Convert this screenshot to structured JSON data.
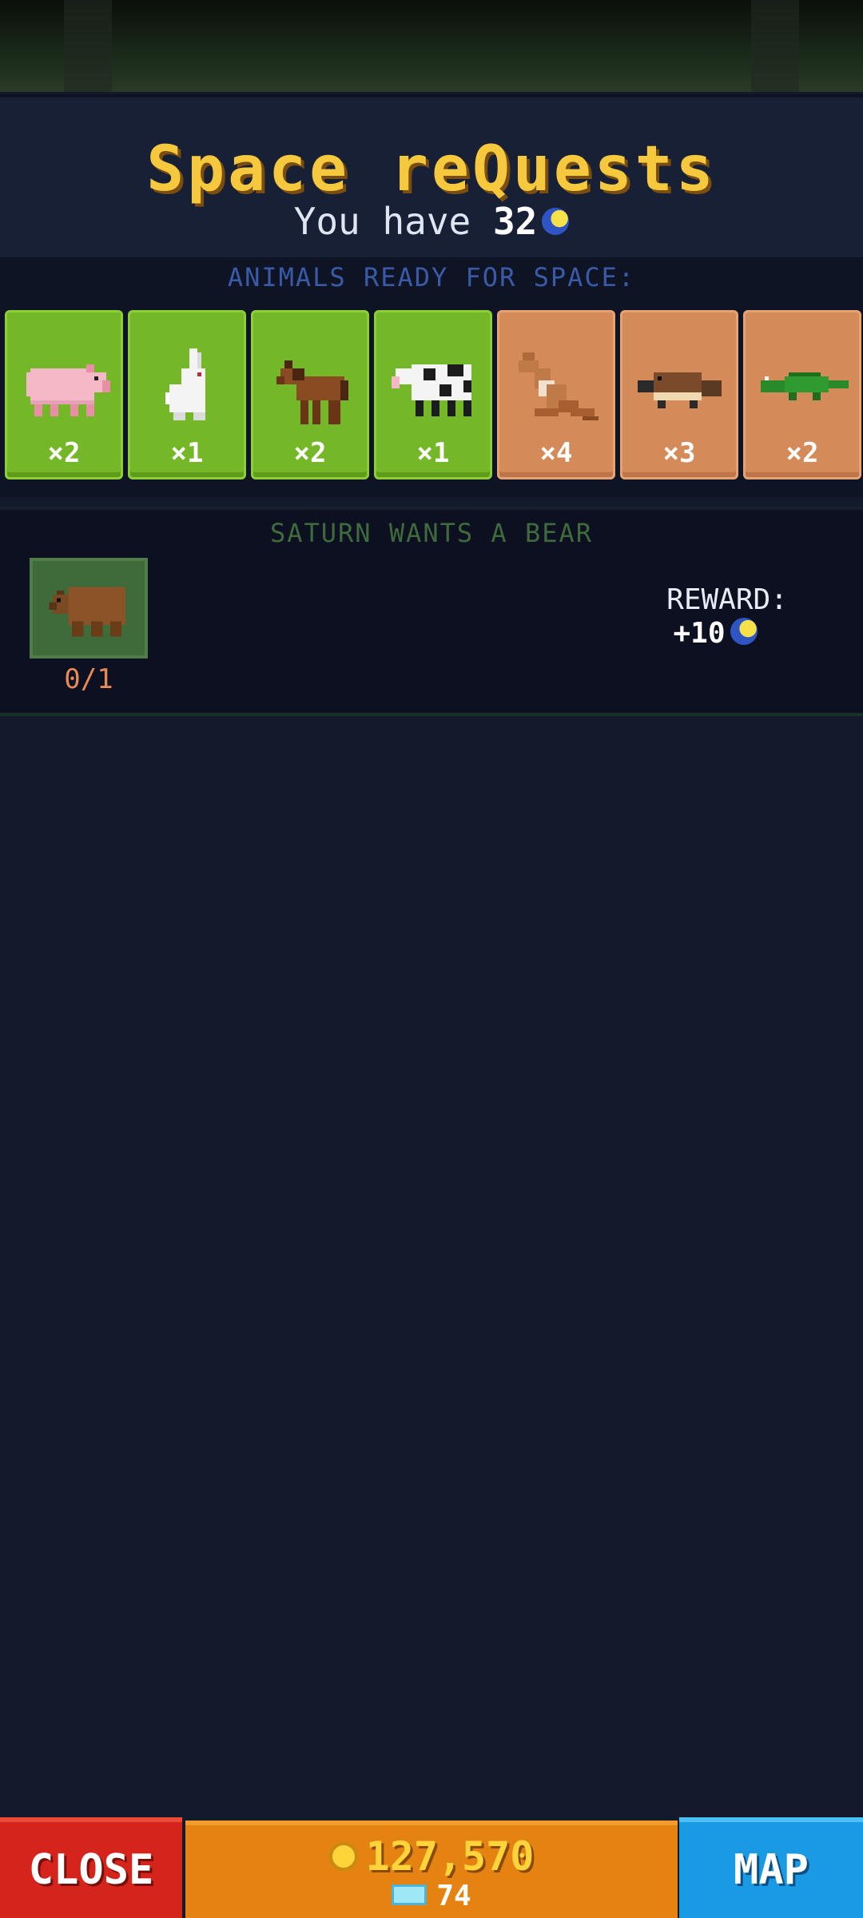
{
  "header": {
    "title": "Space reQuests",
    "you_have_prefix": "You have",
    "moon_coins": "32",
    "moon_icon": "moon-coin-icon"
  },
  "animals_ready": {
    "label": "ANIMALS READY FOR SPACE:",
    "cards": [
      {
        "animal": "pig",
        "count": "×2",
        "color": "#74b728"
      },
      {
        "animal": "rabbit",
        "count": "×1",
        "color": "#74b728"
      },
      {
        "animal": "horse",
        "count": "×2",
        "color": "#74b728"
      },
      {
        "animal": "cow",
        "count": "×1",
        "color": "#74b728"
      },
      {
        "animal": "kangaroo",
        "count": "×4",
        "color": "#d58a5a"
      },
      {
        "animal": "platypus",
        "count": "×3",
        "color": "#d58a5a"
      },
      {
        "animal": "crocodile",
        "count": "×2",
        "color": "#d58a5a"
      }
    ]
  },
  "quest": {
    "label": "SATURN WANTS A BEAR",
    "animal": "bear",
    "progress": "0/1",
    "reward_label": "REWARD:",
    "reward_value": "+10"
  },
  "bottom": {
    "close_label": "CLOSE",
    "coins": "127,570",
    "gems": "74",
    "map_label": "MAP"
  }
}
